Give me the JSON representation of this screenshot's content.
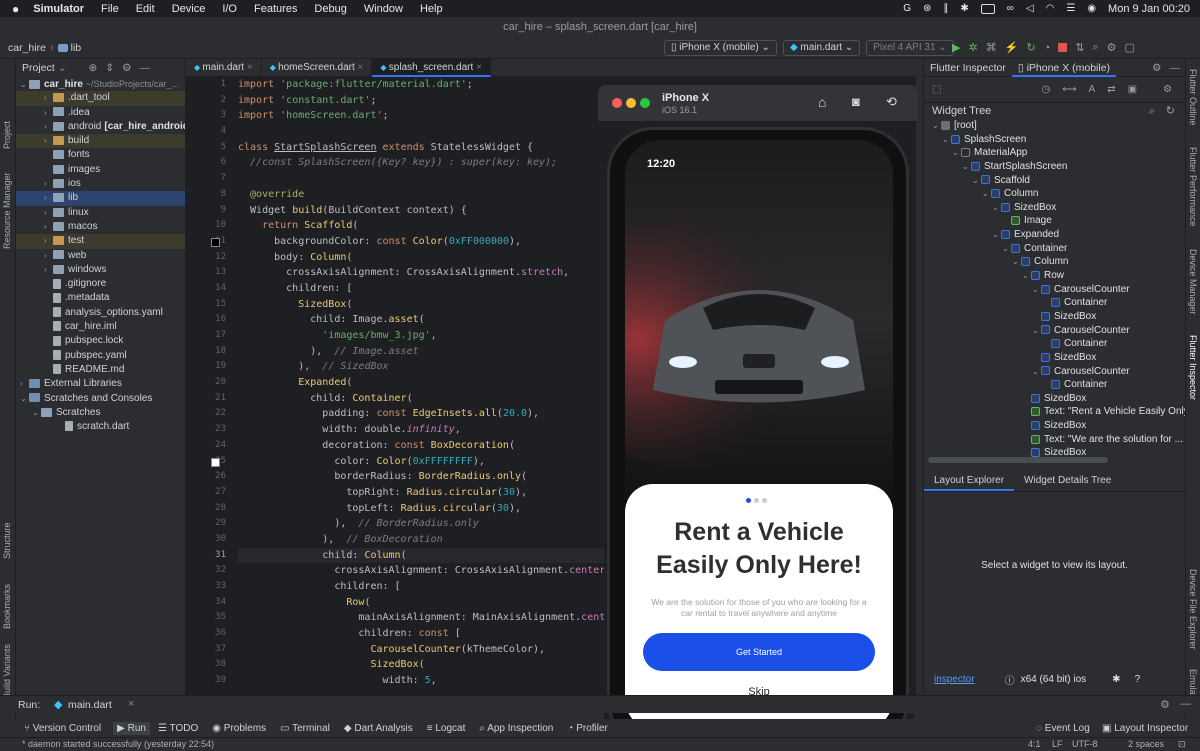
{
  "menubar": {
    "app": "Simulator",
    "items": [
      "File",
      "Edit",
      "Device",
      "I/O",
      "Features",
      "Debug",
      "Window",
      "Help"
    ],
    "clock": "Mon 9 Jan  00:20"
  },
  "window": {
    "title": "car_hire – splash_screen.dart [car_hire]"
  },
  "toolbar": {
    "breadcrumb_project": "car_hire",
    "breadcrumb_folder": "lib",
    "device_selector": "iPhone X (mobile)",
    "run_config": "main.dart",
    "avd_selector": "Pixel 4 API 31"
  },
  "project_panel": {
    "title": "Project",
    "root_name": "car_hire",
    "root_path": "~/StudioProjects/car_...",
    "items": [
      {
        "label": ".dart_tool",
        "indent": 2,
        "kind": "folder",
        "arrow": "›",
        "style": "excl"
      },
      {
        "label": ".idea",
        "indent": 2,
        "kind": "folder",
        "arrow": "›",
        "style": ""
      },
      {
        "label": "android",
        "extra": "[car_hire_android]",
        "indent": 2,
        "kind": "folder",
        "arrow": "›",
        "style": ""
      },
      {
        "label": "build",
        "indent": 2,
        "kind": "folder",
        "arrow": "›",
        "style": "excl"
      },
      {
        "label": "fonts",
        "indent": 2,
        "kind": "folder",
        "arrow": "",
        "style": ""
      },
      {
        "label": "images",
        "indent": 2,
        "kind": "folder",
        "arrow": "",
        "style": ""
      },
      {
        "label": "ios",
        "indent": 2,
        "kind": "folder",
        "arrow": "›",
        "style": ""
      },
      {
        "label": "lib",
        "indent": 2,
        "kind": "folder",
        "arrow": "›",
        "style": "sel"
      },
      {
        "label": "linux",
        "indent": 2,
        "kind": "folder",
        "arrow": "›",
        "style": ""
      },
      {
        "label": "macos",
        "indent": 2,
        "kind": "folder",
        "arrow": "›",
        "style": ""
      },
      {
        "label": "test",
        "indent": 2,
        "kind": "folder",
        "arrow": "›",
        "style": "excl"
      },
      {
        "label": "web",
        "indent": 2,
        "kind": "folder",
        "arrow": "›",
        "style": ""
      },
      {
        "label": "windows",
        "indent": 2,
        "kind": "folder",
        "arrow": "›",
        "style": ""
      },
      {
        "label": ".gitignore",
        "indent": 2,
        "kind": "file",
        "arrow": "",
        "style": ""
      },
      {
        "label": ".metadata",
        "indent": 2,
        "kind": "file",
        "arrow": "",
        "style": ""
      },
      {
        "label": "analysis_options.yaml",
        "indent": 2,
        "kind": "file",
        "arrow": "",
        "style": ""
      },
      {
        "label": "car_hire.iml",
        "indent": 2,
        "kind": "file",
        "arrow": "",
        "style": ""
      },
      {
        "label": "pubspec.lock",
        "indent": 2,
        "kind": "file",
        "arrow": "",
        "style": ""
      },
      {
        "label": "pubspec.yaml",
        "indent": 2,
        "kind": "file",
        "arrow": "",
        "style": ""
      },
      {
        "label": "README.md",
        "indent": 2,
        "kind": "file",
        "arrow": "",
        "style": ""
      },
      {
        "label": "External Libraries",
        "indent": 0,
        "kind": "lib",
        "arrow": "›",
        "style": ""
      },
      {
        "label": "Scratches and Consoles",
        "indent": 0,
        "kind": "lib",
        "arrow": "⌄",
        "style": ""
      },
      {
        "label": "Scratches",
        "indent": 1,
        "kind": "folder",
        "arrow": "⌄",
        "style": ""
      },
      {
        "label": "scratch.dart",
        "indent": 3,
        "kind": "file",
        "arrow": "",
        "style": ""
      }
    ]
  },
  "left_stripe": [
    "Project",
    "Resource Manager",
    "Structure",
    "Bookmarks",
    "Build Variants"
  ],
  "editor": {
    "tabs": [
      "main.dart",
      "homeScreen.dart",
      "splash_screen.dart"
    ],
    "active_tab": 2,
    "first_line": 1,
    "current_line": 31,
    "lines": [
      [
        [
          "import ",
          "kw"
        ],
        [
          "'package:flutter/material.dart'",
          "str"
        ],
        [
          ";",
          "p"
        ]
      ],
      [
        [
          "import ",
          "kw"
        ],
        [
          "'constant.dart'",
          "str"
        ],
        [
          ";",
          "p"
        ]
      ],
      [
        [
          "import ",
          "kw"
        ],
        [
          "'homeScreen.dart'",
          "str"
        ],
        [
          ";",
          "p"
        ]
      ],
      [],
      [
        [
          "class ",
          "kw"
        ],
        [
          "StartSplashScreen",
          "cls"
        ],
        [
          " extends ",
          "kw"
        ],
        [
          "StatelessWidget",
          "p"
        ],
        [
          " {",
          "p"
        ]
      ],
      [
        [
          "  //const SplashScreen({Key? key}) : super(key: key);",
          "cm"
        ]
      ],
      [],
      [
        [
          "  @override",
          "ann"
        ]
      ],
      [
        [
          "  Widget ",
          "p"
        ],
        [
          "build",
          "fn"
        ],
        [
          "(BuildContext context) {",
          "p"
        ]
      ],
      [
        [
          "    return ",
          "kw"
        ],
        [
          "Scaffold",
          "fn"
        ],
        [
          "(",
          "p"
        ]
      ],
      [
        [
          "      backgroundColor: ",
          "p"
        ],
        [
          "const ",
          "kw"
        ],
        [
          "Color",
          "fn"
        ],
        [
          "(",
          "p"
        ],
        [
          "0xFF000000",
          "num"
        ],
        [
          "),",
          "p"
        ]
      ],
      [
        [
          "      body: ",
          "p"
        ],
        [
          "Column",
          "fn"
        ],
        [
          "(",
          "p"
        ]
      ],
      [
        [
          "        crossAxisAlignment: CrossAxisAlignment.",
          "p"
        ],
        [
          "stretch",
          "prop"
        ],
        [
          ",",
          "p"
        ]
      ],
      [
        [
          "        children: [",
          "p"
        ]
      ],
      [
        [
          "          SizedBox",
          "fn"
        ],
        [
          "(",
          "p"
        ]
      ],
      [
        [
          "            child: Image.",
          "p"
        ],
        [
          "asset",
          "fn"
        ],
        [
          "(",
          "p"
        ]
      ],
      [
        [
          "              'images/bmw_3.jpg'",
          "str"
        ],
        [
          ",",
          "p"
        ]
      ],
      [
        [
          "            ),  ",
          "p"
        ],
        [
          "// Image.asset",
          "cm"
        ]
      ],
      [
        [
          "          ),  ",
          "p"
        ],
        [
          "// SizedBox",
          "cm"
        ]
      ],
      [
        [
          "          Expanded",
          "fn"
        ],
        [
          "(",
          "p"
        ]
      ],
      [
        [
          "            child: ",
          "p"
        ],
        [
          "Container",
          "fn"
        ],
        [
          "(",
          "p"
        ]
      ],
      [
        [
          "              padding: ",
          "p"
        ],
        [
          "const ",
          "kw"
        ],
        [
          "EdgeInsets.all",
          "fn"
        ],
        [
          "(",
          "p"
        ],
        [
          "20.0",
          "num"
        ],
        [
          "),",
          "p"
        ]
      ],
      [
        [
          "              width: double.",
          "p"
        ],
        [
          "infinity",
          "it"
        ],
        [
          ",",
          "p"
        ]
      ],
      [
        [
          "              decoration: ",
          "p"
        ],
        [
          "const ",
          "kw"
        ],
        [
          "BoxDecoration",
          "fn"
        ],
        [
          "(",
          "p"
        ]
      ],
      [
        [
          "                color: ",
          "p"
        ],
        [
          "Color",
          "fn"
        ],
        [
          "(",
          "p"
        ],
        [
          "0xFFFFFFFF",
          "num"
        ],
        [
          "),",
          "p"
        ]
      ],
      [
        [
          "                borderRadius: ",
          "p"
        ],
        [
          "BorderRadius.only",
          "fn"
        ],
        [
          "(",
          "p"
        ]
      ],
      [
        [
          "                  topRight: ",
          "p"
        ],
        [
          "Radius.circular",
          "fn"
        ],
        [
          "(",
          "p"
        ],
        [
          "30",
          "num"
        ],
        [
          "),",
          "p"
        ]
      ],
      [
        [
          "                  topLeft: ",
          "p"
        ],
        [
          "Radius.circular",
          "fn"
        ],
        [
          "(",
          "p"
        ],
        [
          "30",
          "num"
        ],
        [
          "),",
          "p"
        ]
      ],
      [
        [
          "                ),  ",
          "p"
        ],
        [
          "// BorderRadius.only",
          "cm"
        ]
      ],
      [
        [
          "              ),  ",
          "p"
        ],
        [
          "// BoxDecoration",
          "cm"
        ]
      ],
      [
        [
          "              child: ",
          "p"
        ],
        [
          "Column",
          "fn"
        ],
        [
          "(",
          "p"
        ]
      ],
      [
        [
          "                crossAxisAlignment: CrossAxisAlignment.",
          "p"
        ],
        [
          "center",
          "prop"
        ],
        [
          ",",
          "p"
        ]
      ],
      [
        [
          "                children: [",
          "p"
        ]
      ],
      [
        [
          "                  Row",
          "fn"
        ],
        [
          "(",
          "p"
        ]
      ],
      [
        [
          "                    mainAxisAlignment: MainAxisAlignment.",
          "p"
        ],
        [
          "center",
          "prop"
        ],
        [
          ",",
          "p"
        ]
      ],
      [
        [
          "                    children: ",
          "p"
        ],
        [
          "const ",
          "kw"
        ],
        [
          "[",
          "p"
        ]
      ],
      [
        [
          "                      CarouselCounter",
          "fn"
        ],
        [
          "(kThemeColor),",
          "p"
        ]
      ],
      [
        [
          "                      SizedBox",
          "fn"
        ],
        [
          "(",
          "p"
        ]
      ],
      [
        [
          "                        width: ",
          "p"
        ],
        [
          "5",
          "num"
        ],
        [
          ",",
          "p"
        ]
      ]
    ]
  },
  "simulator": {
    "device": "iPhone X",
    "os": "iOS 16.1",
    "time": "12:20",
    "headline_1": "Rent a Vehicle",
    "headline_2": "Easily Only Here!",
    "subtitle_1": "We are the solution for those of you who are looking for a",
    "subtitle_2": "car rental to travel anywhere and anytime",
    "cta": "Get Started",
    "skip": "Skip",
    "accent": "#1a4fe8"
  },
  "flutter_inspector": {
    "tabs": [
      "Flutter Inspector",
      "iPhone X (mobile)"
    ],
    "widget_tree_title": "Widget Tree",
    "nodes": [
      {
        "label": "[root]",
        "indent": 0,
        "icon": "folder",
        "arrow": "⌄"
      },
      {
        "label": "SplashScreen",
        "indent": 1,
        "icon": "blue",
        "arrow": "⌄"
      },
      {
        "label": "MaterialApp",
        "indent": 2,
        "icon": "gray",
        "arrow": "⌄"
      },
      {
        "label": "StartSplashScreen",
        "indent": 3,
        "icon": "blue",
        "arrow": "⌄"
      },
      {
        "label": "Scaffold",
        "indent": 4,
        "icon": "blue",
        "arrow": "⌄"
      },
      {
        "label": "Column",
        "indent": 5,
        "icon": "blue",
        "arrow": "⌄"
      },
      {
        "label": "SizedBox",
        "indent": 6,
        "icon": "blue",
        "arrow": "⌄"
      },
      {
        "label": "Image",
        "indent": 7,
        "icon": "green",
        "arrow": ""
      },
      {
        "label": "Expanded",
        "indent": 6,
        "icon": "blue",
        "arrow": "⌄"
      },
      {
        "label": "Container",
        "indent": 7,
        "icon": "blue",
        "arrow": "⌄"
      },
      {
        "label": "Column",
        "indent": 8,
        "icon": "blue",
        "arrow": "⌄"
      },
      {
        "label": "Row",
        "indent": 9,
        "icon": "blue",
        "arrow": "⌄"
      },
      {
        "label": "CarouselCounter",
        "indent": 10,
        "icon": "blue",
        "arrow": "⌄"
      },
      {
        "label": "Container",
        "indent": 11,
        "icon": "blue",
        "arrow": ""
      },
      {
        "label": "SizedBox",
        "indent": 10,
        "icon": "blue",
        "arrow": ""
      },
      {
        "label": "CarouselCounter",
        "indent": 10,
        "icon": "blue",
        "arrow": "⌄"
      },
      {
        "label": "Container",
        "indent": 11,
        "icon": "blue",
        "arrow": ""
      },
      {
        "label": "SizedBox",
        "indent": 10,
        "icon": "blue",
        "arrow": ""
      },
      {
        "label": "CarouselCounter",
        "indent": 10,
        "icon": "blue",
        "arrow": "⌄"
      },
      {
        "label": "Container",
        "indent": 11,
        "icon": "blue",
        "arrow": ""
      },
      {
        "label": "SizedBox",
        "indent": 9,
        "icon": "blue",
        "arrow": ""
      },
      {
        "label": "Text: \"Rent a Vehicle Easily Only ...",
        "indent": 9,
        "icon": "green",
        "arrow": ""
      },
      {
        "label": "SizedBox",
        "indent": 9,
        "icon": "blue",
        "arrow": ""
      },
      {
        "label": "Text: \"We are the solution for ...",
        "indent": 9,
        "icon": "green",
        "arrow": ""
      },
      {
        "label": "SizedBox",
        "indent": 9,
        "icon": "blue",
        "arrow": ""
      }
    ],
    "layout_tabs": [
      "Layout Explorer",
      "Widget Details Tree"
    ],
    "empty_message": "Select a widget to view its layout.",
    "inspector_link": "inspector",
    "arch": "x64 (64 bit) ios"
  },
  "right_stripe": [
    "Flutter Outline",
    "Flutter Performance",
    "Device Manager",
    "Flutter Inspector",
    "Device File Explorer",
    "Emulator"
  ],
  "run_bar": {
    "label": "Run:",
    "config": "main.dart"
  },
  "bottom_tabs": [
    "Version Control",
    "Run",
    "TODO",
    "Problems",
    "Terminal",
    "Dart Analysis",
    "Logcat",
    "App Inspection",
    "Profiler"
  ],
  "bottom_right_tabs": [
    "Event Log",
    "Layout Inspector"
  ],
  "status": {
    "message": "* daemon started successfully (yesterday 22:54)",
    "position": "4:1",
    "line_sep": "LF",
    "encoding": "UTF-8",
    "indent": "2 spaces"
  }
}
